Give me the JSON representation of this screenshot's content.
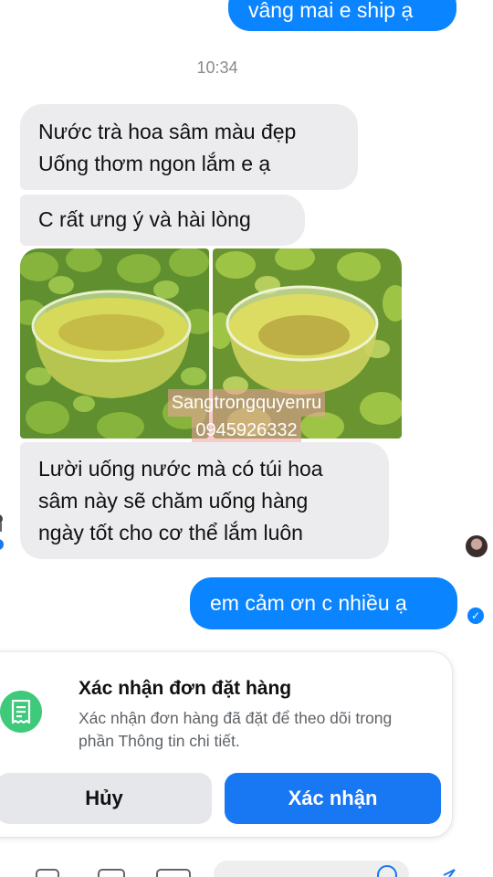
{
  "messages_out": [
    {
      "text": "vâng mai e ship ạ"
    },
    {
      "text": "em cảm ơn c nhiều ạ"
    }
  ],
  "timestamp": "10:34",
  "messages_in": [
    {
      "lines": [
        "Nước trà hoa sâm màu đẹp",
        "Uống thơm ngon lắm e ạ"
      ]
    },
    {
      "lines": [
        "C rất ưng ý và hài lòng"
      ]
    },
    {
      "lines": [
        "Lười uống nước mà có túi hoa",
        "sâm này sẽ chăm uống hàng",
        "ngày tốt cho cơ thể lắm luôn"
      ]
    }
  ],
  "watermark": {
    "line1": "Sangtrongquyenru",
    "line2": "0945926332"
  },
  "order_card": {
    "title": "Xác nhận đơn đặt hàng",
    "description": "Xác nhận đơn hàng đã đặt để theo dõi trong phần Thông tin chi tiết.",
    "cancel_label": "Hủy",
    "confirm_label": "Xác nhận",
    "icon": "receipt-icon"
  },
  "colors": {
    "outgoing_bubble": "#0a84ff",
    "incoming_bubble": "#ececee",
    "confirm_button": "#1877f2",
    "card_icon_bg": "#3fc97a"
  }
}
